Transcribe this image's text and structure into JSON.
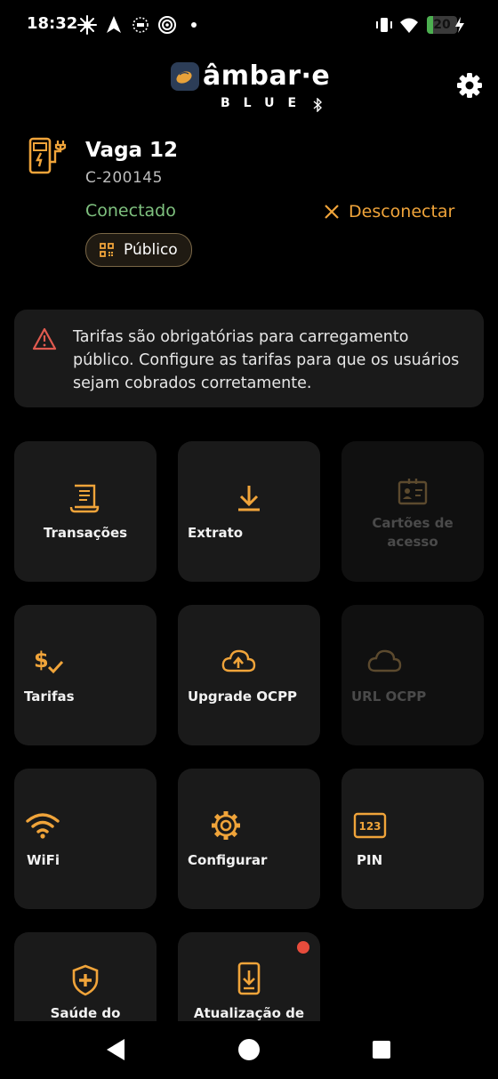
{
  "status_bar": {
    "time": "18:32",
    "battery_percent": 20,
    "battery_label": "20",
    "icons": [
      "pinwheel-icon",
      "navigation-arrow-icon",
      "wear-os-icon",
      "signal-spiral-icon",
      "dot-icon",
      "vibrate-icon",
      "wifi-icon",
      "battery-charging-icon"
    ]
  },
  "header": {
    "logo_word": "âmbar·e",
    "logo_sub": "BLUE",
    "settings_icon": "gear-icon"
  },
  "charger": {
    "name": "Vaga 12",
    "id": "C-200145",
    "status": "Conectado",
    "disconnect_label": "Desconectar",
    "chip_label": "Público",
    "status_color": "#7fc17f",
    "accent_color": "#f0a43a"
  },
  "alert": {
    "text": "Tarifas são obrigatórias para carregamento público. Configure as tarifas para que os usuários sejam cobrados corretamente.",
    "icon": "warning-triangle-icon",
    "icon_color": "#e05a4f"
  },
  "tiles": [
    {
      "label": "Transações",
      "icon": "receipt-icon",
      "enabled": true
    },
    {
      "label": "Extrato",
      "icon": "download-icon",
      "enabled": true
    },
    {
      "label": "Cartões de acesso",
      "icon": "id-card-icon",
      "enabled": false
    },
    {
      "label": "Tarifas",
      "icon": "dollar-check-icon",
      "enabled": true
    },
    {
      "label": "Upgrade OCPP",
      "icon": "cloud-upload-icon",
      "enabled": true
    },
    {
      "label": "URL OCPP",
      "icon": "cloud-icon",
      "enabled": false
    },
    {
      "label": "WiFi",
      "icon": "wifi-icon",
      "enabled": true
    },
    {
      "label": "Configurar",
      "icon": "gear-icon",
      "enabled": true
    },
    {
      "label": "PIN",
      "icon": "pin-123-icon",
      "enabled": true
    },
    {
      "label": "Saúde do",
      "icon": "shield-plus-icon",
      "enabled": true
    },
    {
      "label": "Atualização de",
      "icon": "phone-download-icon",
      "enabled": true,
      "badge": true
    }
  ],
  "nav": [
    "back-icon",
    "home-icon",
    "recents-icon"
  ]
}
